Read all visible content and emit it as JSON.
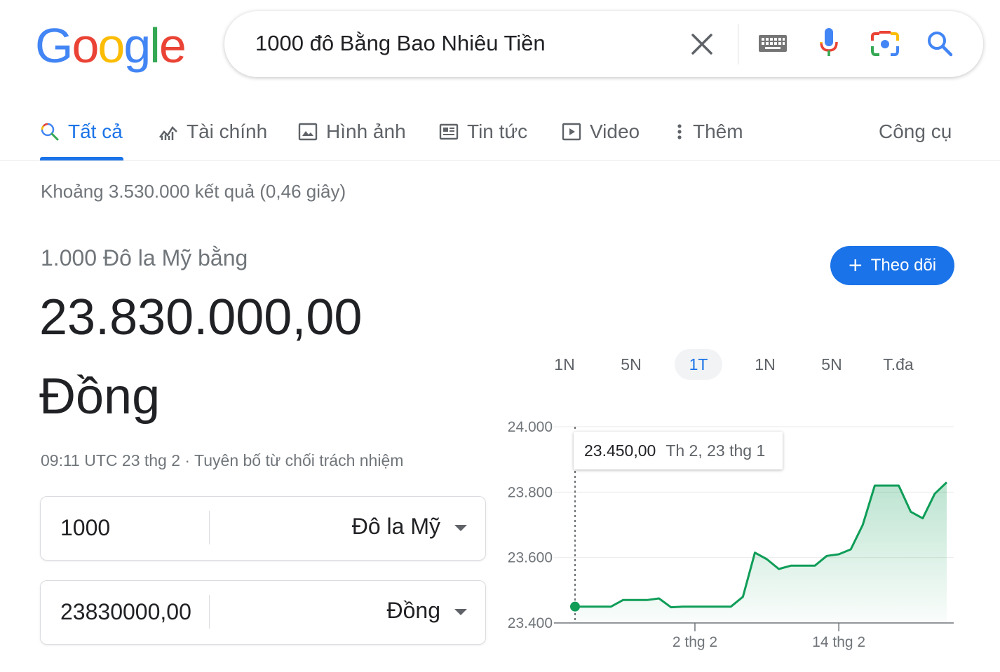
{
  "logo": "Google",
  "search": {
    "query": "1000 đô Bằng Bao Nhiêu Tiền"
  },
  "tabs": [
    {
      "label": "Tất cả",
      "icon": "search-icon",
      "active": true
    },
    {
      "label": "Tài chính",
      "icon": "finance-chart-icon",
      "active": false
    },
    {
      "label": "Hình ảnh",
      "icon": "image-icon",
      "active": false
    },
    {
      "label": "Tin tức",
      "icon": "news-icon",
      "active": false
    },
    {
      "label": "Video",
      "icon": "video-icon",
      "active": false
    },
    {
      "label": "Thêm",
      "icon": "more-vert-icon",
      "active": false
    }
  ],
  "tools_label": "Công cụ",
  "result_stats": "Khoảng 3.530.000 kết quả (0,46 giây)",
  "converter": {
    "from_label": "1.000 Đô la Mỹ bằng",
    "value": "23.830.000,00",
    "unit": "Đồng",
    "timestamp": "09:11 UTC 23 thg 2 · Tuyên bố từ chối trách nhiệm",
    "from_amount": "1000",
    "from_currency": "Đô la Mỹ",
    "to_amount": "23830000,00",
    "to_currency": "Đồng"
  },
  "follow_button": "Theo dõi",
  "ranges": [
    {
      "label": "1N",
      "active": false
    },
    {
      "label": "5N",
      "active": false
    },
    {
      "label": "1T",
      "active": true
    },
    {
      "label": "1N",
      "active": false
    },
    {
      "label": "5N",
      "active": false
    },
    {
      "label": "T.đa",
      "active": false
    }
  ],
  "tooltip": {
    "value": "23.450,00",
    "date": "Th 2, 23 thg 1"
  },
  "colors": {
    "accent": "#1a73e8",
    "line": "#0f9d58"
  },
  "chart_data": {
    "type": "area",
    "ylim": [
      23400,
      24000
    ],
    "yticks": [
      "24.000",
      "23.800",
      "23.600",
      "23.400"
    ],
    "ytick_values": [
      24000,
      23800,
      23600,
      23400
    ],
    "xticks": [
      {
        "label": "2 thg 2",
        "index": 10
      },
      {
        "label": "14 thg 2",
        "index": 22
      }
    ],
    "values": [
      23450,
      23450,
      23450,
      23450,
      23470,
      23470,
      23470,
      23475,
      23448,
      23450,
      23450,
      23450,
      23450,
      23450,
      23480,
      23615,
      23595,
      23565,
      23575,
      23575,
      23575,
      23605,
      23610,
      23625,
      23700,
      23820,
      23820,
      23820,
      23740,
      23720,
      23795,
      23830
    ]
  }
}
